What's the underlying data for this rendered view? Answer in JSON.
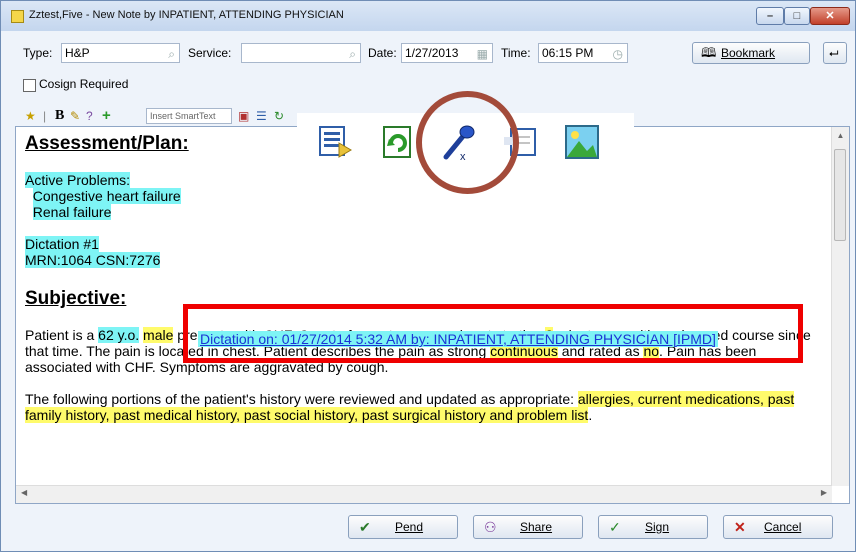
{
  "window": {
    "title": "Zztest,Five - New Note by INPATIENT, ATTENDING PHYSICIAN",
    "controls": {
      "minimize": "–",
      "maximize": "□",
      "close": "✕"
    }
  },
  "form": {
    "type_label": "Type:",
    "type_value": "H&P",
    "service_label": "Service:",
    "service_value": "",
    "date_label": "Date:",
    "date_value": "1/27/2013",
    "time_label": "Time:",
    "time_value": "06:15 PM",
    "bookmark_label": "Bookmark",
    "cosign_label": "Cosign Required"
  },
  "toolbar": {
    "smarttext_placeholder": "Insert SmartText"
  },
  "note": {
    "assessment_heading": "Assessment/Plan:",
    "active_problems_label": "Active Problems:",
    "problems": [
      "Congestive heart failure",
      "Renal failure"
    ],
    "dictation_num": "Dictation #1",
    "mrn_line": "MRN:1064  CSN:7276",
    "subjective_heading": "Subjective:",
    "dictation_link": "Dictation on: 01/27/2014  5:32 AM by: INPATIENT, ATTENDING PHYSICIAN [IPMD]",
    "para1_a": "Patient is a ",
    "para1_age": "62 y.o.",
    "para1_sp": " ",
    "para1_male": "male",
    "para1_b": " presents with CHF. Onset of symptoms was abrupt starting ",
    "para1_num": "2",
    "para1_c": " minute ago with unchanged course since that time. The pain is located in chest. Patient describes the pain as strong ",
    "para1_cont": "continuous",
    "para1_d": " and rated as ",
    "para1_no": "no",
    "para1_e": ". Pain has been associated with CHF. Symptoms are aggravated by cough.",
    "para2_a": "The following portions of the patient's history were reviewed and updated as appropriate: ",
    "para2_hl": "allergies, current medications, past family history, past medical history, past social history, past surgical history and problem list",
    "para2_b": "."
  },
  "buttons": {
    "pend": "Pend",
    "share": "Share",
    "sign": "Sign",
    "cancel": "Cancel"
  },
  "colors": {
    "highlight_cyan": "#7ef4f5",
    "highlight_yellow": "#fffb6b",
    "annotation_red": "#ef0000",
    "annotation_circle": "#a34b3a"
  }
}
